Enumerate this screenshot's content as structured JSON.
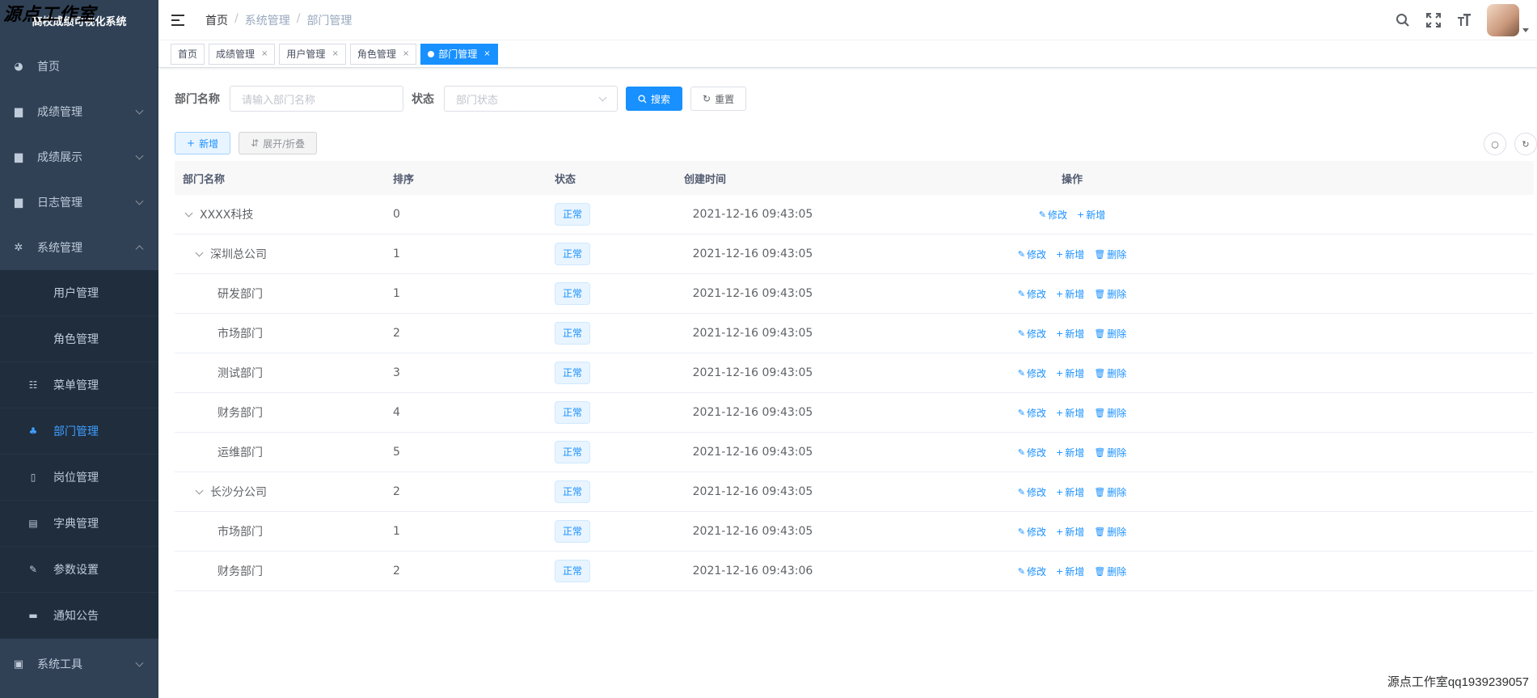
{
  "app": {
    "title": "高校成绩可视化系统",
    "watermark_top": "源点工作室",
    "watermark_bottom": "源点工作室qq1939239057"
  },
  "sidebar": {
    "items": [
      {
        "label": "首页",
        "icon": "dashboard-icon"
      },
      {
        "label": "成绩管理",
        "icon": "folder-icon"
      },
      {
        "label": "成绩展示",
        "icon": "folder-icon"
      },
      {
        "label": "日志管理",
        "icon": "folder-icon"
      },
      {
        "label": "系统管理",
        "icon": "gear-icon"
      }
    ],
    "subitems": [
      {
        "label": "用户管理"
      },
      {
        "label": "角色管理"
      },
      {
        "label": "菜单管理",
        "icon": "tree-table-icon"
      },
      {
        "label": "部门管理",
        "icon": "tree-icon"
      },
      {
        "label": "岗位管理",
        "icon": "post-icon"
      },
      {
        "label": "字典管理",
        "icon": "dict-icon"
      },
      {
        "label": "参数设置",
        "icon": "edit-icon"
      },
      {
        "label": "通知公告",
        "icon": "message-icon"
      }
    ],
    "tools": {
      "label": "系统工具",
      "icon": "toolbox-icon"
    }
  },
  "breadcrumb": {
    "home": "首页",
    "parent": "系统管理",
    "current": "部门管理"
  },
  "tags": [
    {
      "label": "首页"
    },
    {
      "label": "成绩管理"
    },
    {
      "label": "用户管理"
    },
    {
      "label": "角色管理"
    },
    {
      "label": "部门管理"
    }
  ],
  "search": {
    "name_label": "部门名称",
    "name_placeholder": "请输入部门名称",
    "status_label": "状态",
    "status_placeholder": "部门状态",
    "search_btn": "搜索",
    "reset_btn": "重置"
  },
  "toolbar": {
    "add_btn": "新增",
    "expand_btn": "展开/折叠"
  },
  "table": {
    "headers": {
      "name": "部门名称",
      "sort": "排序",
      "status": "状态",
      "time": "创建时间",
      "op": "操作"
    },
    "ops": {
      "edit": "修改",
      "add": "新增",
      "delete": "删除"
    },
    "rows": [
      {
        "name": "XXXX科技",
        "sort": "0",
        "status": "正常",
        "time": "2021-12-16 09:43:05"
      },
      {
        "name": "深圳总公司",
        "sort": "1",
        "status": "正常",
        "time": "2021-12-16 09:43:05"
      },
      {
        "name": "研发部门",
        "sort": "1",
        "status": "正常",
        "time": "2021-12-16 09:43:05"
      },
      {
        "name": "市场部门",
        "sort": "2",
        "status": "正常",
        "time": "2021-12-16 09:43:05"
      },
      {
        "name": "测试部门",
        "sort": "3",
        "status": "正常",
        "time": "2021-12-16 09:43:05"
      },
      {
        "name": "财务部门",
        "sort": "4",
        "status": "正常",
        "time": "2021-12-16 09:43:05"
      },
      {
        "name": "运维部门",
        "sort": "5",
        "status": "正常",
        "time": "2021-12-16 09:43:05"
      },
      {
        "name": "长沙分公司",
        "sort": "2",
        "status": "正常",
        "time": "2021-12-16 09:43:05"
      },
      {
        "name": "市场部门",
        "sort": "1",
        "status": "正常",
        "time": "2021-12-16 09:43:05"
      },
      {
        "name": "财务部门",
        "sort": "2",
        "status": "正常",
        "time": "2021-12-16 09:43:06"
      }
    ]
  }
}
